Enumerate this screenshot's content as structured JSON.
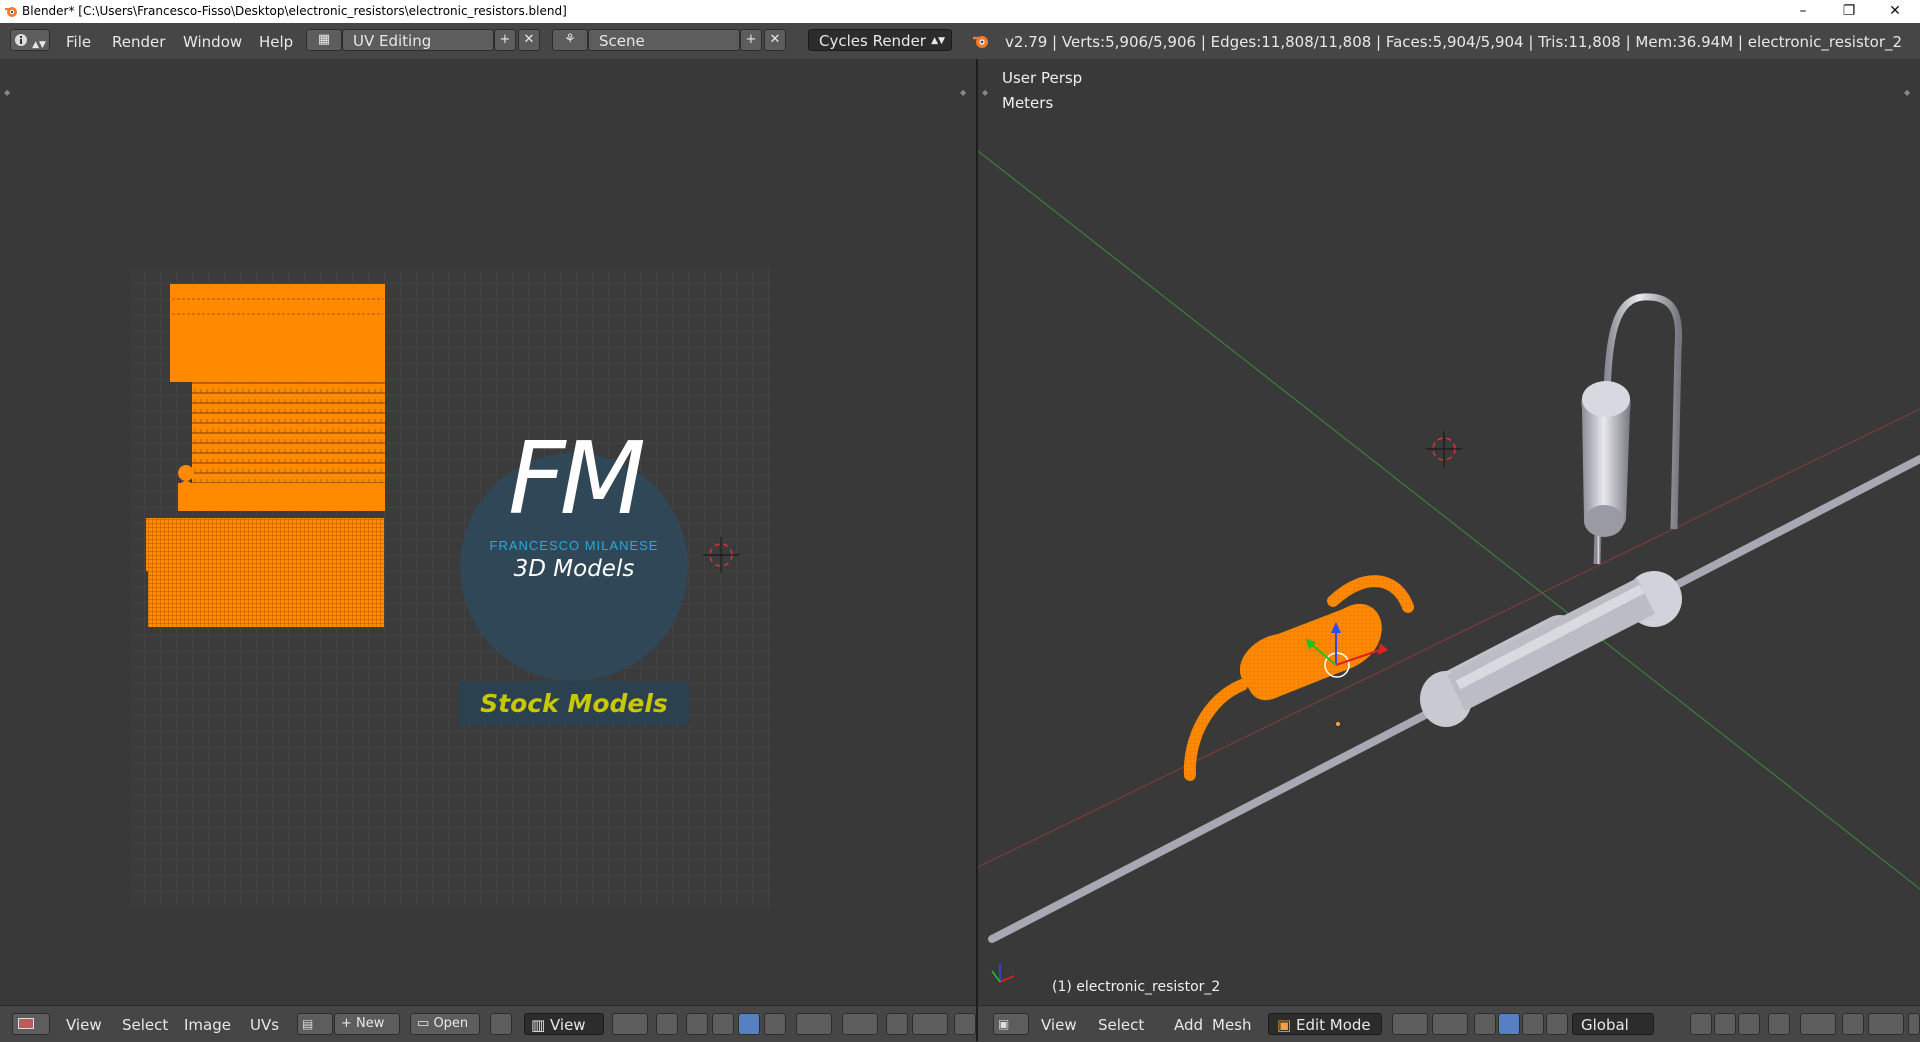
{
  "window": {
    "title": "Blender* [C:\\Users\\Francesco-Fisso\\Desktop\\electronic_resistors\\electronic_resistors.blend]",
    "minimize": "–",
    "maximize": "❐",
    "close": "✕"
  },
  "infobar": {
    "menus": [
      "File",
      "Render",
      "Window",
      "Help"
    ],
    "screen_layout": "UV Editing",
    "scene": "Scene",
    "render_engine": "Cycles Render",
    "stats": "v2.79 | Verts:5,906/5,906 | Edges:11,808/11,808 | Faces:5,904/5,904 | Tris:11,808 | Mem:36.94M | electronic_resistor_2"
  },
  "uv_editor": {
    "image": {
      "logo_letters": "FM",
      "logo_name": "FRANCESCO MILANESE",
      "logo_subtitle": "3D Models",
      "banner": "Stock Models"
    },
    "footer": {
      "menus": [
        "View",
        "Select",
        "Image",
        "UVs"
      ],
      "new_label": "New",
      "open_label": "Open",
      "view_label": "View"
    }
  },
  "viewport": {
    "view_name": "User Persp",
    "units": "Meters",
    "object_label": "(1) electronic_resistor_2",
    "footer": {
      "menus": [
        "View",
        "Select",
        "Add",
        "Mesh"
      ],
      "mode": "Edit Mode",
      "orientation": "Global"
    }
  },
  "colors": {
    "accent_orange": "#ff8a00",
    "background": "#393939",
    "header": "#464646",
    "logo_blue": "#2aa8e0",
    "banner_yellow": "#c8c800"
  }
}
